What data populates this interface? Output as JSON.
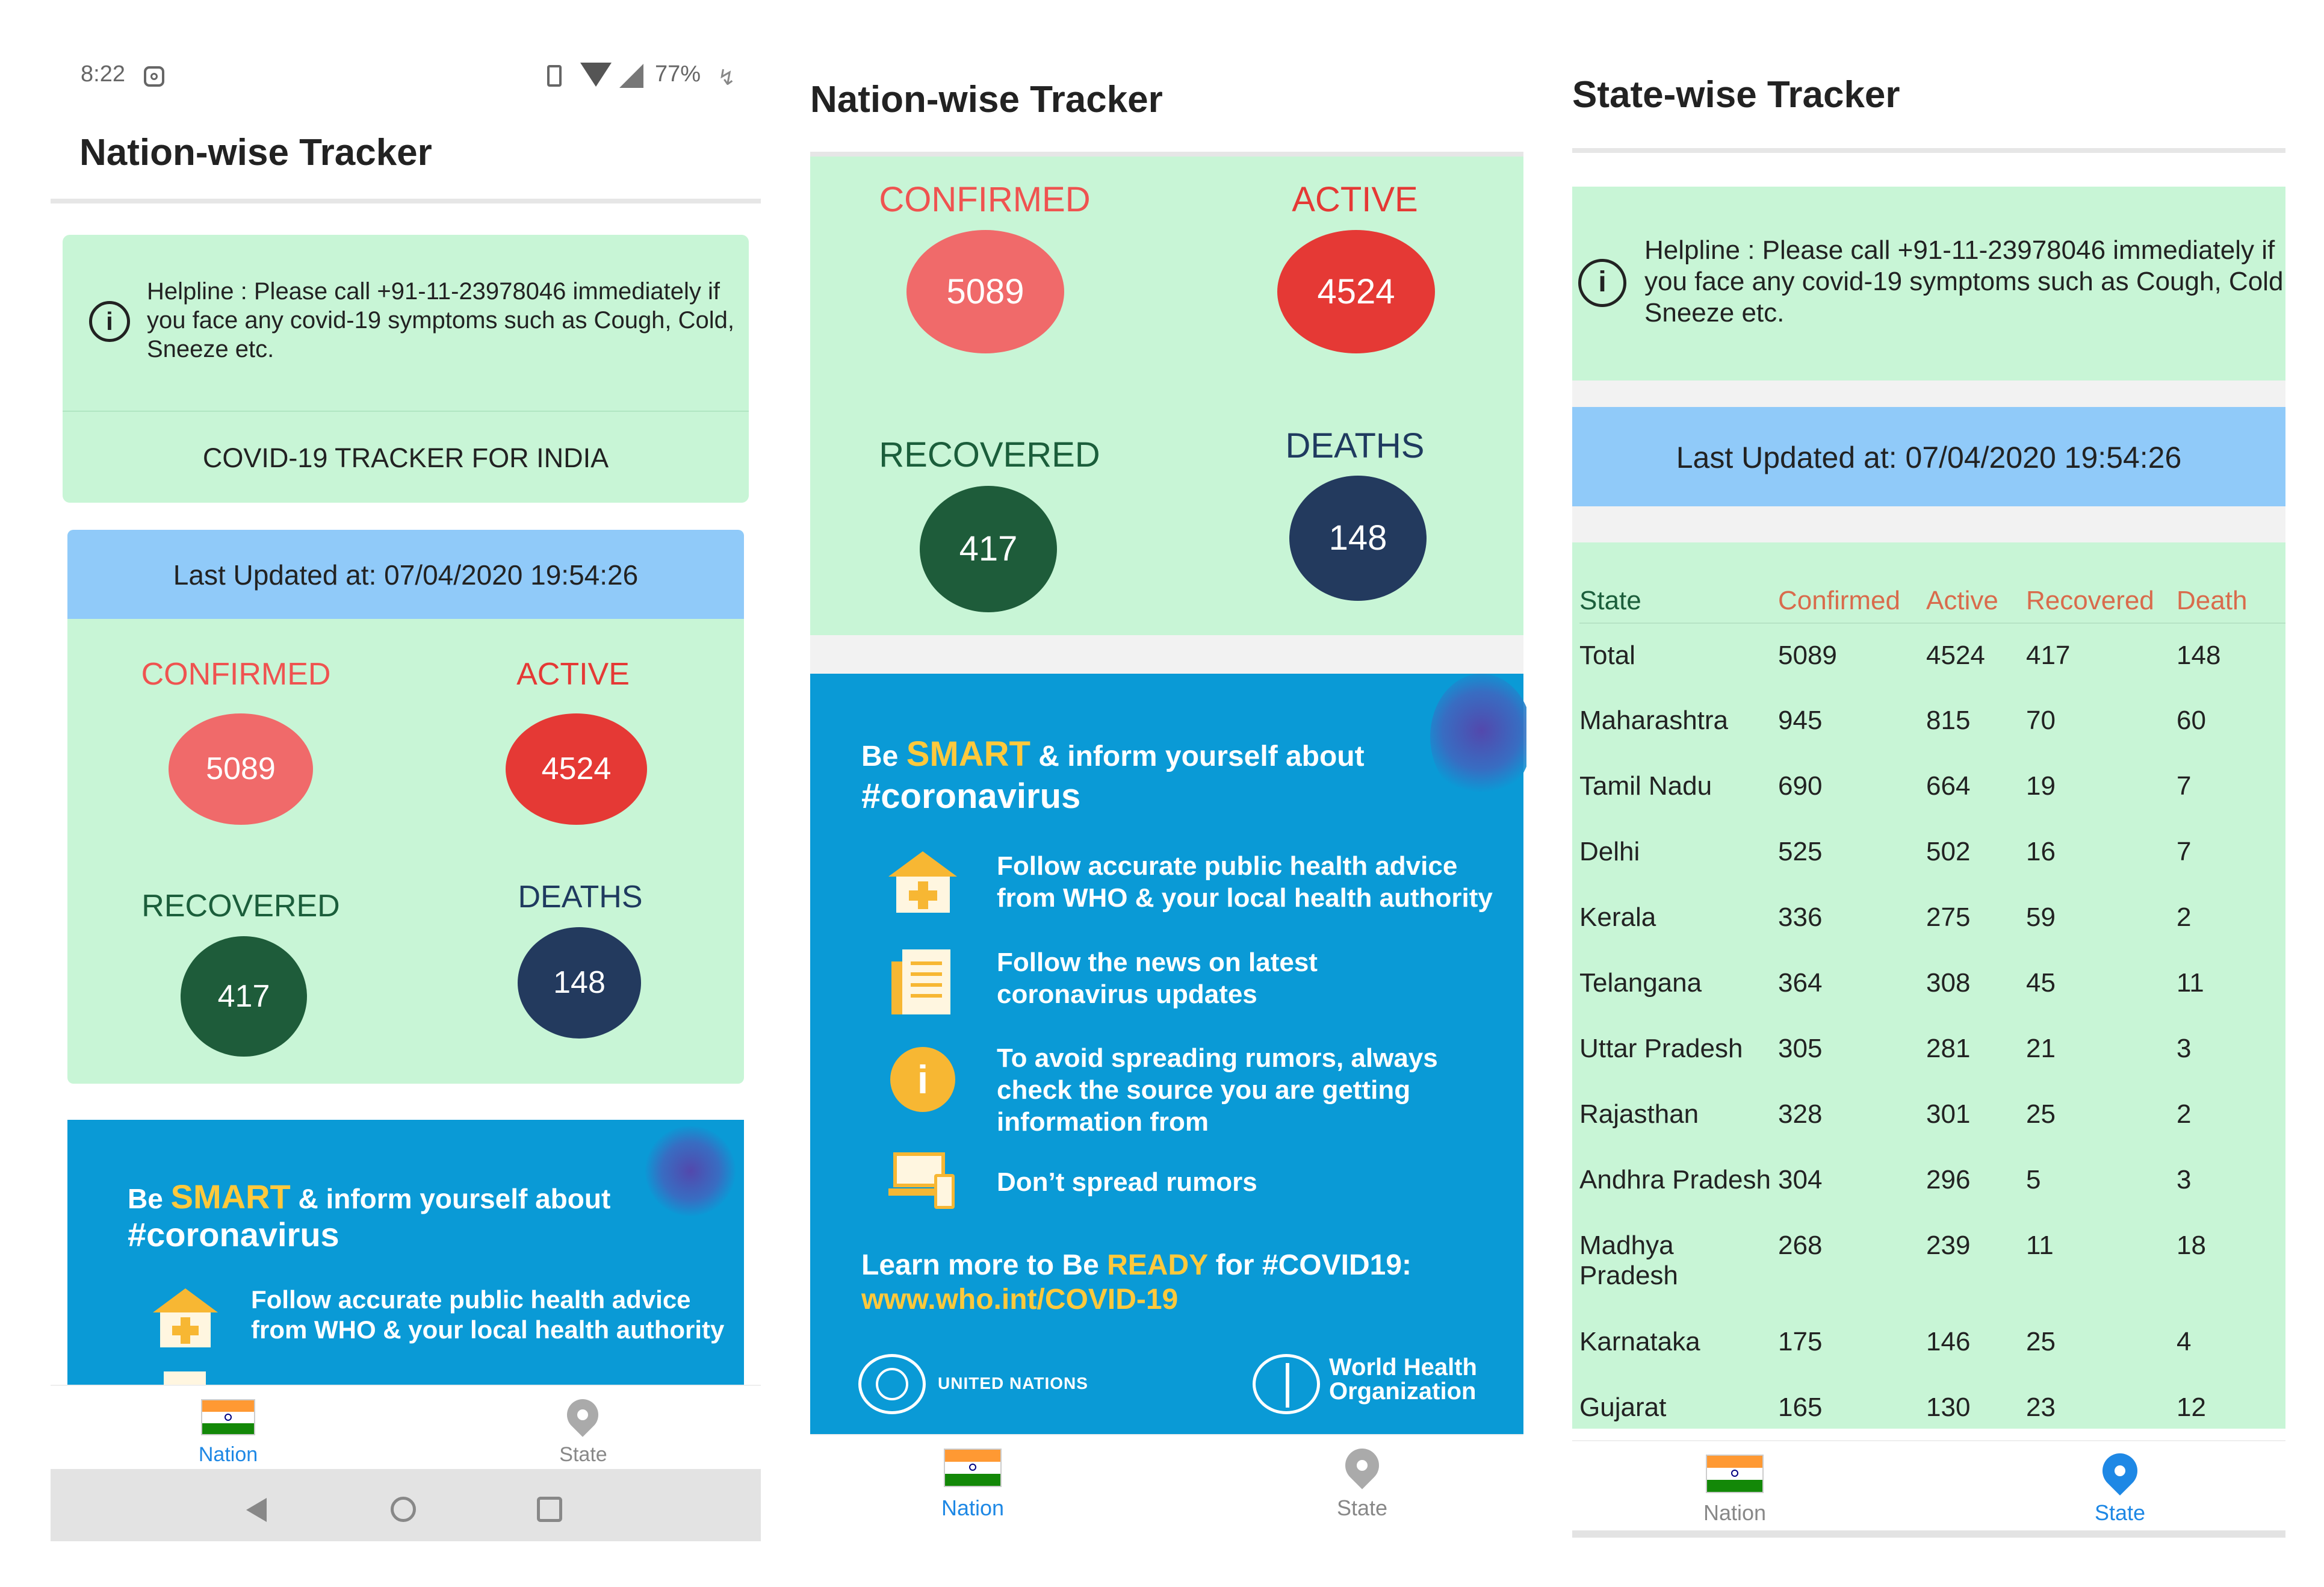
{
  "status_bar": {
    "time": "8:22",
    "battery": "77%"
  },
  "nation": {
    "title": "Nation-wise Tracker",
    "helpline": "Helpline : Please call +91-11-23978046 immediately if you face any covid-19 symptoms such as Cough, Cold, Sneeze etc.",
    "tracker_title": "COVID-19 TRACKER FOR INDIA",
    "last_updated": "Last Updated at: 07/04/2020 19:54:26",
    "stats": {
      "confirmed_label": "CONFIRMED",
      "confirmed": "5089",
      "active_label": "ACTIVE",
      "active": "4524",
      "recovered_label": "RECOVERED",
      "recovered": "417",
      "deaths_label": "DEATHS",
      "deaths": "148"
    }
  },
  "who_poster": {
    "be": "Be",
    "smart": "SMART",
    "inform": "& inform yourself about",
    "hashtag": "#coronavirus",
    "items": [
      {
        "icon": "hospital-icon",
        "text1": "Follow accurate public health advice",
        "text2": "from WHO & your local health authority"
      },
      {
        "icon": "newspaper-icon",
        "text1": "Follow the news on latest",
        "text2": "coronavirus updates"
      },
      {
        "icon": "info-icon",
        "text1": "To avoid spreading rumors, always",
        "text2": "check the source you are getting",
        "text3": "information from"
      },
      {
        "icon": "devices-icon",
        "text1": "Don’t spread rumors"
      }
    ],
    "learn_pre": "Learn more to Be",
    "ready": "READY",
    "learn_post": "for #COVID19:",
    "url": "www.who.int/COVID-19",
    "un_label": "UNITED NATIONS",
    "who_label1": "World Health",
    "who_label2": "Organization"
  },
  "nav": {
    "nation": "Nation",
    "state": "State"
  },
  "state": {
    "title": "State-wise Tracker",
    "helpline_line1": "Helpline : Please call +91-11-23978046 immediately if",
    "helpline_line2": "you face any covid-19 symptoms such as Cough, Cold",
    "helpline_line3": "Sneeze etc.",
    "last_updated": "Last Updated at: 07/04/2020 19:54:26",
    "columns": [
      "State",
      "Confirmed",
      "Active",
      "Recovered",
      "Death"
    ],
    "rows": [
      [
        "Total",
        "5089",
        "4524",
        "417",
        "148"
      ],
      [
        "Maharashtra",
        "945",
        "815",
        "70",
        "60"
      ],
      [
        "Tamil Nadu",
        "690",
        "664",
        "19",
        "7"
      ],
      [
        "Delhi",
        "525",
        "502",
        "16",
        "7"
      ],
      [
        "Kerala",
        "336",
        "275",
        "59",
        "2"
      ],
      [
        "Telangana",
        "364",
        "308",
        "45",
        "11"
      ],
      [
        "Uttar Pradesh",
        "305",
        "281",
        "21",
        "3"
      ],
      [
        "Rajasthan",
        "328",
        "301",
        "25",
        "2"
      ],
      [
        "Andhra Pradesh",
        "304",
        "296",
        "5",
        "3"
      ],
      [
        "Madhya Pradesh",
        "268",
        "239",
        "11",
        "18"
      ],
      [
        "Karnataka",
        "175",
        "146",
        "25",
        "4"
      ],
      [
        "Gujarat",
        "165",
        "130",
        "23",
        "12"
      ]
    ]
  }
}
